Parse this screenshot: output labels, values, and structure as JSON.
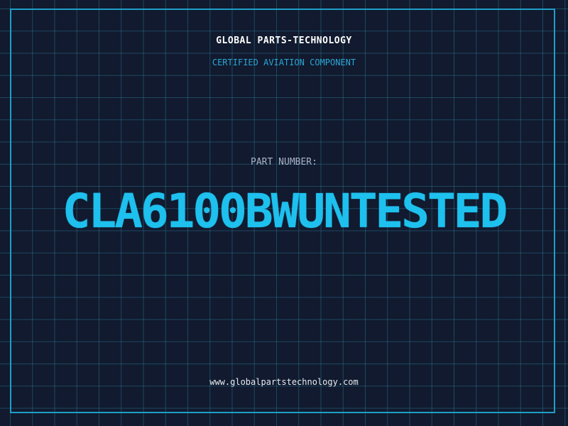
{
  "header": {
    "brand": "GLOBAL PARTS-TECHNOLOGY",
    "tagline": "CERTIFIED AVIATION COMPONENT"
  },
  "part": {
    "label": "PART NUMBER:",
    "number": "CLA6100BWUNTESTED"
  },
  "footer": {
    "website": "www.globalpartstechnology.com"
  },
  "colors": {
    "background": "#111a2e",
    "accent": "#1ec0ee",
    "grid": "#286e8c"
  }
}
